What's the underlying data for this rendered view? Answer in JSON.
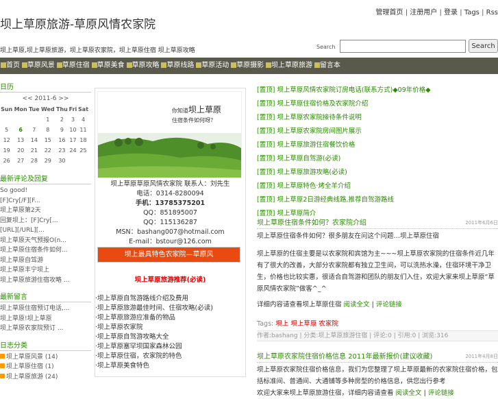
{
  "top_nav": [
    "管理首页",
    "注册用户",
    "登录",
    "Tags",
    "Rss"
  ],
  "site": {
    "title": "坝上草原旅游-草原风情农家院",
    "slogan": "坝上草原,坝上草原旅游，坝上草原农家院，坝上草原住宿 坝上草原攻略"
  },
  "search": {
    "label": "Search",
    "value": "",
    "button": "Search"
  },
  "menu": [
    "首页",
    "草原风景",
    "草原住宿",
    "草原美食",
    "草原攻略",
    "草原线路",
    "草原活动",
    "草原摄影",
    "坝上草原旅游",
    "留言本"
  ],
  "calendar": {
    "title": "日历",
    "nav": "<< 2011-6 >>",
    "weekdays": [
      "Sun",
      "Mon",
      "Tue",
      "Wed",
      "Thu",
      "Fri",
      "Sat"
    ],
    "rows": [
      [
        "",
        "",
        "",
        "1",
        "2",
        "3",
        "4"
      ],
      [
        "5",
        "6",
        "7",
        "8",
        "9",
        "10",
        "11"
      ],
      [
        "12",
        "13",
        "14",
        "15",
        "16",
        "17",
        "18"
      ],
      [
        "19",
        "20",
        "21",
        "22",
        "23",
        "24",
        "25"
      ],
      [
        "26",
        "27",
        "28",
        "29",
        "30",
        "",
        ""
      ]
    ],
    "today": "6"
  },
  "comments": {
    "title": "最新评论及回复",
    "items": [
      "So good!",
      "[F]Cry[/F][F...",
      "坝上草原第2天",
      "回复坝上：[F]Cry[...",
      "[URL][/URL][...",
      "坝上草原天气预报O(n...",
      "坝上草原住宿条件如何...",
      "坝上草原自驾游",
      "坝上草原丰宁坝上",
      "坝上草原旅游住宿攻略 ..."
    ]
  },
  "notices": {
    "title": "最新留言",
    "items": [
      "坝上草原住宿预订电话,...",
      "坝上草原!坝上草原",
      "坝上草原农家院预订 ..."
    ]
  },
  "categories": {
    "title": "日志分类",
    "items": [
      {
        "name": "坝上草原风景",
        "count": "(14)"
      },
      {
        "name": "坝上草原住宿",
        "count": "(1)"
      },
      {
        "name": "坝上草原旅游",
        "count": "(24)"
      }
    ]
  },
  "banner": {
    "q1": "你知道",
    "q1b": "坝上草原",
    "q2": "住宿条件如何呀？"
  },
  "contact": {
    "line1": "坝上草原草原风情农家院 联系人：刘先生",
    "line2": "电话：0314-8280094",
    "line3": "手机：13785375201",
    "line4": "QQ：851895007",
    "line5": "QQ：115136287",
    "line6": "MSN：bashang007@hotmail.com",
    "line7": "E-mail：bstour@126.com"
  },
  "redbar": "坝上最具特色农家院—草原风",
  "hot": "坝上草原旅游推荐(必读)",
  "mid_links": [
    "坝上草原自驾游路线介绍及费用",
    "坝上草原旅游最佳时间、住宿攻略(必读)",
    "坝上草原旅游应准备的物品",
    "坝上草原农家院",
    "坝上草原自驾游攻略大全",
    "坝上草原塞罕坝国家森林公园",
    "坝上草原住宿，农家院的特色",
    "坝上草原美食特色"
  ],
  "right_links": [
    "[置顶] 坝上草原风情农家院订房电话(联系方式)◆09年价格◆",
    "[置顶] 坝上草原住宿价格及农家院介绍",
    "[置顶] 坝上草原农家院接待条件说明",
    "[置顶] 坝上草原农家院房间图片展示",
    "[置顶] 坝上草原旅游住宿餐饮价格",
    "[置顶] 坝上草原自驾游(必读)",
    "[置顶] 坝上草原旅游攻略(必读)",
    "[置顶] 坝上草原特色·烤全羊介绍",
    "[置顶] 坝上草原2日游经典线路,推荐自驾游路线",
    "[置顶] 坝上草原简介"
  ],
  "post1": {
    "title": "坝上草原住宿条件如何？农家院介绍",
    "date": "2011年6月6日",
    "p1": "坝上草原住宿条件如何？很多朋友在问这个问题…坝上草原住宿",
    "p2": "坝上草原的住宿主要是以农家院和宾馆为主~~~坝上草原农家院的住宿条件近几年有了很大的改善，大部分农家院都有独立卫生间，可以洗热水澡，住宿环境干净卫生，价格也比较实惠，很适合自驾游和团队的朋友们入住，欢迎大家来坝上草原“草原风情农家院”做客^_^",
    "p3": "详细内容请查看坝上草原住宿",
    "read_more": "阅读全文",
    "comment": "评论链接",
    "tags_label": "Tags:",
    "tags": [
      "坝上",
      "坝上草原",
      "农家院"
    ],
    "meta": "作者:bashang | 分类:坝上草原旅游住宿 | 评论:0 | 引用:0 | 浏览:316"
  },
  "post2": {
    "title": "坝上草原农家院住宿价格信息 2011年最新报价(建议收藏)",
    "date": "2011年4月8日",
    "p1": "坝上草原农家院住宿价格信息，我们为您整理了坝上草原最新的农家院住宿价格，包括标准间、普通间、大通铺等多种房型的价格信息，供您出行参考",
    "p2": "欢迎大家来坝上草原旅游住宿，详细内容请查看",
    "read_more": "阅读全文",
    "comment": "评论链接"
  },
  "colors": {
    "accent": "#2a8a00",
    "menubar": "#5a5a4c",
    "red": "#e84a10"
  }
}
